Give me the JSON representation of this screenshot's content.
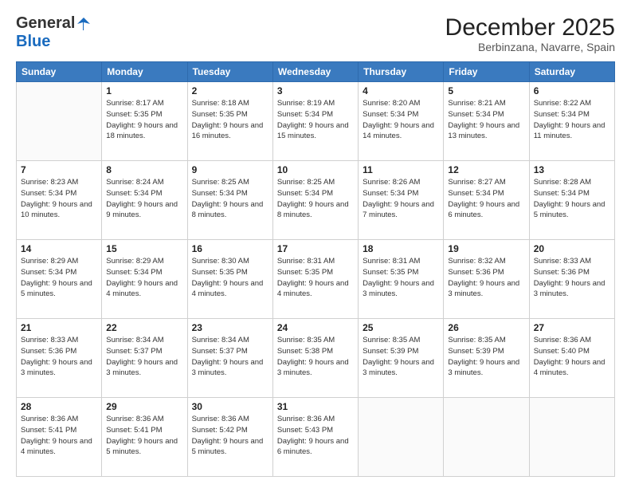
{
  "logo": {
    "general": "General",
    "blue": "Blue"
  },
  "title": "December 2025",
  "location": "Berbinzana, Navarre, Spain",
  "weekdays": [
    "Sunday",
    "Monday",
    "Tuesday",
    "Wednesday",
    "Thursday",
    "Friday",
    "Saturday"
  ],
  "weeks": [
    [
      {
        "day": "",
        "sunrise": "",
        "sunset": "",
        "daylight": ""
      },
      {
        "day": "1",
        "sunrise": "Sunrise: 8:17 AM",
        "sunset": "Sunset: 5:35 PM",
        "daylight": "Daylight: 9 hours and 18 minutes."
      },
      {
        "day": "2",
        "sunrise": "Sunrise: 8:18 AM",
        "sunset": "Sunset: 5:35 PM",
        "daylight": "Daylight: 9 hours and 16 minutes."
      },
      {
        "day": "3",
        "sunrise": "Sunrise: 8:19 AM",
        "sunset": "Sunset: 5:34 PM",
        "daylight": "Daylight: 9 hours and 15 minutes."
      },
      {
        "day": "4",
        "sunrise": "Sunrise: 8:20 AM",
        "sunset": "Sunset: 5:34 PM",
        "daylight": "Daylight: 9 hours and 14 minutes."
      },
      {
        "day": "5",
        "sunrise": "Sunrise: 8:21 AM",
        "sunset": "Sunset: 5:34 PM",
        "daylight": "Daylight: 9 hours and 13 minutes."
      },
      {
        "day": "6",
        "sunrise": "Sunrise: 8:22 AM",
        "sunset": "Sunset: 5:34 PM",
        "daylight": "Daylight: 9 hours and 11 minutes."
      }
    ],
    [
      {
        "day": "7",
        "sunrise": "Sunrise: 8:23 AM",
        "sunset": "Sunset: 5:34 PM",
        "daylight": "Daylight: 9 hours and 10 minutes."
      },
      {
        "day": "8",
        "sunrise": "Sunrise: 8:24 AM",
        "sunset": "Sunset: 5:34 PM",
        "daylight": "Daylight: 9 hours and 9 minutes."
      },
      {
        "day": "9",
        "sunrise": "Sunrise: 8:25 AM",
        "sunset": "Sunset: 5:34 PM",
        "daylight": "Daylight: 9 hours and 8 minutes."
      },
      {
        "day": "10",
        "sunrise": "Sunrise: 8:25 AM",
        "sunset": "Sunset: 5:34 PM",
        "daylight": "Daylight: 9 hours and 8 minutes."
      },
      {
        "day": "11",
        "sunrise": "Sunrise: 8:26 AM",
        "sunset": "Sunset: 5:34 PM",
        "daylight": "Daylight: 9 hours and 7 minutes."
      },
      {
        "day": "12",
        "sunrise": "Sunrise: 8:27 AM",
        "sunset": "Sunset: 5:34 PM",
        "daylight": "Daylight: 9 hours and 6 minutes."
      },
      {
        "day": "13",
        "sunrise": "Sunrise: 8:28 AM",
        "sunset": "Sunset: 5:34 PM",
        "daylight": "Daylight: 9 hours and 5 minutes."
      }
    ],
    [
      {
        "day": "14",
        "sunrise": "Sunrise: 8:29 AM",
        "sunset": "Sunset: 5:34 PM",
        "daylight": "Daylight: 9 hours and 5 minutes."
      },
      {
        "day": "15",
        "sunrise": "Sunrise: 8:29 AM",
        "sunset": "Sunset: 5:34 PM",
        "daylight": "Daylight: 9 hours and 4 minutes."
      },
      {
        "day": "16",
        "sunrise": "Sunrise: 8:30 AM",
        "sunset": "Sunset: 5:35 PM",
        "daylight": "Daylight: 9 hours and 4 minutes."
      },
      {
        "day": "17",
        "sunrise": "Sunrise: 8:31 AM",
        "sunset": "Sunset: 5:35 PM",
        "daylight": "Daylight: 9 hours and 4 minutes."
      },
      {
        "day": "18",
        "sunrise": "Sunrise: 8:31 AM",
        "sunset": "Sunset: 5:35 PM",
        "daylight": "Daylight: 9 hours and 3 minutes."
      },
      {
        "day": "19",
        "sunrise": "Sunrise: 8:32 AM",
        "sunset": "Sunset: 5:36 PM",
        "daylight": "Daylight: 9 hours and 3 minutes."
      },
      {
        "day": "20",
        "sunrise": "Sunrise: 8:33 AM",
        "sunset": "Sunset: 5:36 PM",
        "daylight": "Daylight: 9 hours and 3 minutes."
      }
    ],
    [
      {
        "day": "21",
        "sunrise": "Sunrise: 8:33 AM",
        "sunset": "Sunset: 5:36 PM",
        "daylight": "Daylight: 9 hours and 3 minutes."
      },
      {
        "day": "22",
        "sunrise": "Sunrise: 8:34 AM",
        "sunset": "Sunset: 5:37 PM",
        "daylight": "Daylight: 9 hours and 3 minutes."
      },
      {
        "day": "23",
        "sunrise": "Sunrise: 8:34 AM",
        "sunset": "Sunset: 5:37 PM",
        "daylight": "Daylight: 9 hours and 3 minutes."
      },
      {
        "day": "24",
        "sunrise": "Sunrise: 8:35 AM",
        "sunset": "Sunset: 5:38 PM",
        "daylight": "Daylight: 9 hours and 3 minutes."
      },
      {
        "day": "25",
        "sunrise": "Sunrise: 8:35 AM",
        "sunset": "Sunset: 5:39 PM",
        "daylight": "Daylight: 9 hours and 3 minutes."
      },
      {
        "day": "26",
        "sunrise": "Sunrise: 8:35 AM",
        "sunset": "Sunset: 5:39 PM",
        "daylight": "Daylight: 9 hours and 3 minutes."
      },
      {
        "day": "27",
        "sunrise": "Sunrise: 8:36 AM",
        "sunset": "Sunset: 5:40 PM",
        "daylight": "Daylight: 9 hours and 4 minutes."
      }
    ],
    [
      {
        "day": "28",
        "sunrise": "Sunrise: 8:36 AM",
        "sunset": "Sunset: 5:41 PM",
        "daylight": "Daylight: 9 hours and 4 minutes."
      },
      {
        "day": "29",
        "sunrise": "Sunrise: 8:36 AM",
        "sunset": "Sunset: 5:41 PM",
        "daylight": "Daylight: 9 hours and 5 minutes."
      },
      {
        "day": "30",
        "sunrise": "Sunrise: 8:36 AM",
        "sunset": "Sunset: 5:42 PM",
        "daylight": "Daylight: 9 hours and 5 minutes."
      },
      {
        "day": "31",
        "sunrise": "Sunrise: 8:36 AM",
        "sunset": "Sunset: 5:43 PM",
        "daylight": "Daylight: 9 hours and 6 minutes."
      },
      {
        "day": "",
        "sunrise": "",
        "sunset": "",
        "daylight": ""
      },
      {
        "day": "",
        "sunrise": "",
        "sunset": "",
        "daylight": ""
      },
      {
        "day": "",
        "sunrise": "",
        "sunset": "",
        "daylight": ""
      }
    ]
  ]
}
